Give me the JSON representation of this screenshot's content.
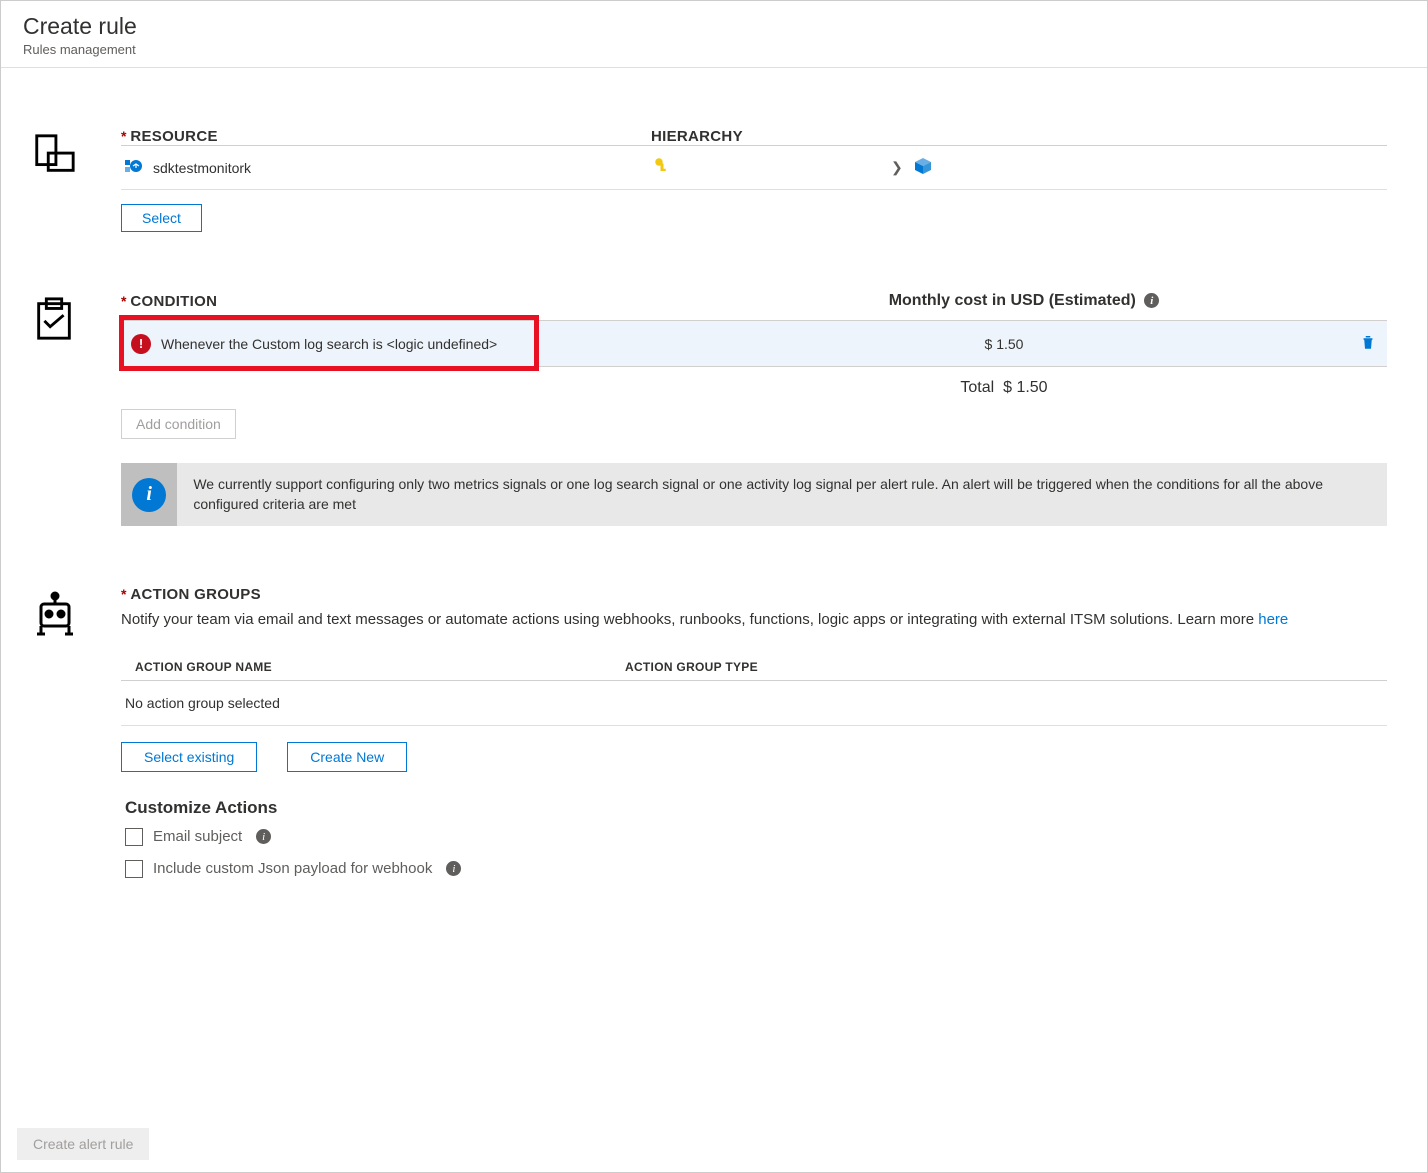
{
  "header": {
    "title": "Create rule",
    "subtitle": "Rules management"
  },
  "resource": {
    "label": "RESOURCE",
    "hierarchy_label": "HIERARCHY",
    "name": "sdktestmonitork",
    "select_btn": "Select"
  },
  "condition": {
    "label": "CONDITION",
    "cost_label": "Monthly cost in USD (Estimated)",
    "item_text": "Whenever the Custom log search is <logic undefined>",
    "item_cost": "$ 1.50",
    "total_label": "Total",
    "total_value": "$ 1.50",
    "add_btn": "Add condition",
    "info_text": "We currently support configuring only two metrics signals or one log search signal or one activity log signal per alert rule. An alert will be triggered when the conditions for all the above configured criteria are met"
  },
  "action_groups": {
    "label": "ACTION GROUPS",
    "description": "Notify your team via email and text messages or automate actions using webhooks, runbooks, functions, logic apps or integrating with external ITSM solutions. Learn more ",
    "learn_more": "here",
    "col_name": "ACTION GROUP NAME",
    "col_type": "ACTION GROUP TYPE",
    "empty": "No action group selected",
    "select_existing": "Select existing",
    "create_new": "Create New",
    "customize_header": "Customize Actions",
    "email_subject": "Email subject",
    "json_payload": "Include custom Json payload for webhook"
  },
  "footer": {
    "create_btn": "Create alert rule"
  }
}
